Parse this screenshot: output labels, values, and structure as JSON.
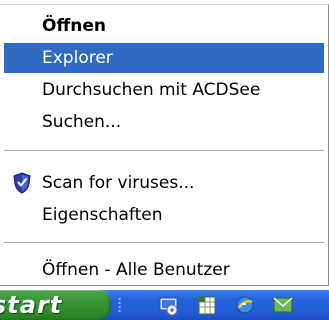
{
  "context_menu": {
    "items": [
      {
        "label": "Öffnen",
        "bold": true,
        "selected": false
      },
      {
        "label": "Explorer",
        "bold": false,
        "selected": true
      },
      {
        "label": "Durchsuchen mit ACDSee",
        "bold": false,
        "selected": false
      },
      {
        "label": "Suchen...",
        "bold": false,
        "selected": false
      },
      {
        "label": "Scan for viruses...",
        "bold": false,
        "selected": false,
        "icon": "shield-icon"
      },
      {
        "label": "Eigenschaften",
        "bold": false,
        "selected": false
      },
      {
        "label": "Öffnen - Alle Benutzer",
        "bold": false,
        "selected": false
      }
    ],
    "colors": {
      "selected_bg": "#316ac5",
      "selected_text": "#ffffff",
      "text": "#000000"
    }
  },
  "taskbar": {
    "start_label": "start",
    "colors": {
      "taskbar": "#245edb",
      "start_button": "#3c9a3a"
    },
    "quick_launch_icons": [
      "desktop-icon",
      "spreadsheet-icon",
      "browser-icon",
      "mail-icon"
    ]
  }
}
